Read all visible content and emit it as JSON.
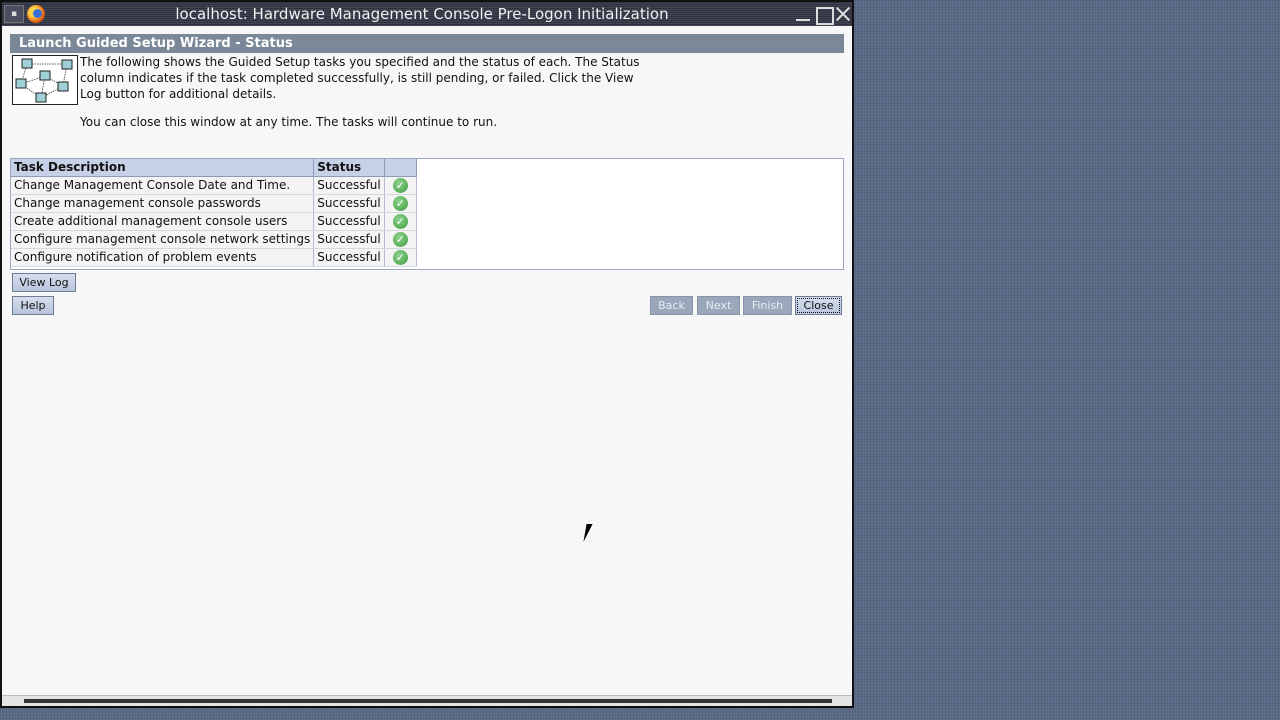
{
  "window": {
    "title": "localhost: Hardware Management Console Pre-Logon Initialization",
    "menu_glyph": "▪"
  },
  "wizard": {
    "header": "Launch Guided Setup Wizard - Status",
    "description": "The following shows the Guided Setup tasks you specified and the status of each. The Status column indicates if the task completed successfully, is still pending, or failed. Click the View Log button for additional details.",
    "note": "You can close this window at any time. The tasks will continue to run."
  },
  "table": {
    "headers": [
      "Task Description",
      "Status",
      ""
    ],
    "rows": [
      {
        "task": "Change Management Console Date and Time.",
        "status": "Successful",
        "icon": "check-icon"
      },
      {
        "task": "Change management console passwords",
        "status": "Successful",
        "icon": "check-icon"
      },
      {
        "task": "Create additional management console users",
        "status": "Successful",
        "icon": "check-icon"
      },
      {
        "task": "Configure management console network settings",
        "status": "Successful",
        "icon": "check-icon"
      },
      {
        "task": "Configure notification of problem events",
        "status": "Successful",
        "icon": "check-icon"
      }
    ]
  },
  "buttons": {
    "view_log": "View Log",
    "help": "Help",
    "back": "Back",
    "next": "Next",
    "finish": "Finish",
    "close": "Close"
  },
  "colors": {
    "header_bg": "#7a8898",
    "table_header_bg": "#c6d0e6",
    "button_bg": "#c8d2e6",
    "disabled_button_bg": "#9aa7bb",
    "success_green": "#3c9a3c"
  }
}
